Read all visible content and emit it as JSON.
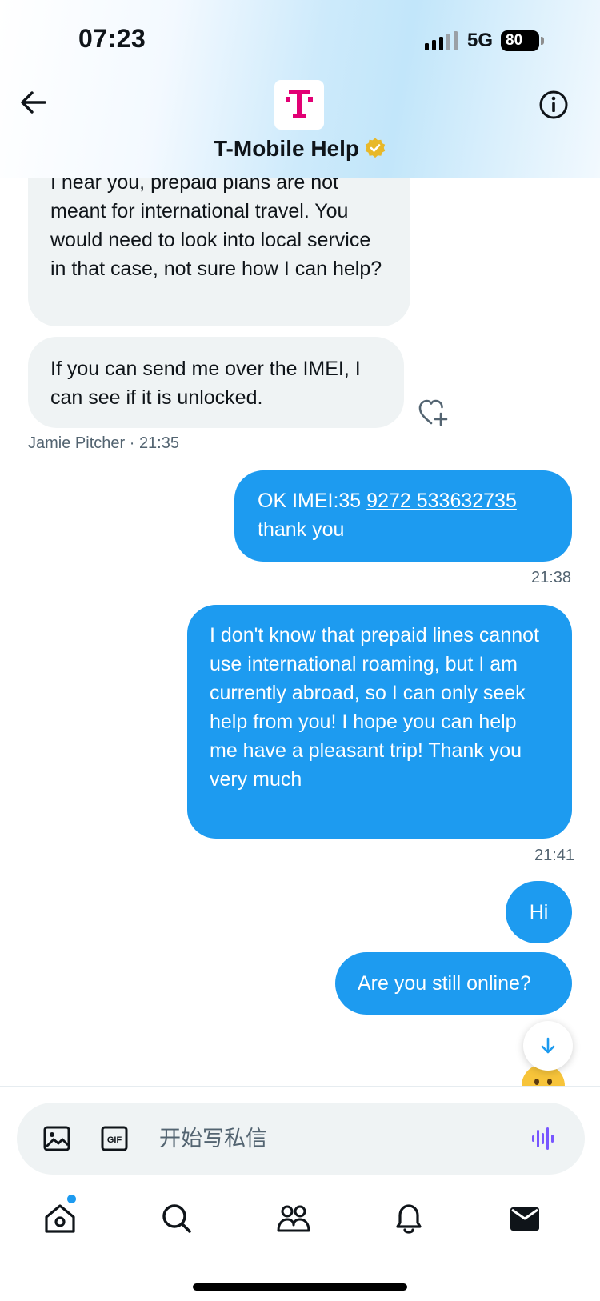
{
  "status_bar": {
    "time": "07:23",
    "network": "5G",
    "battery": "80"
  },
  "header": {
    "contact_name": "T-Mobile Help",
    "logo_letter": "T",
    "brand_color": "#e20074"
  },
  "messages": [
    {
      "direction": "incoming",
      "text": "I hear you, prepaid plans are not meant for international travel. You would need to look into local service in that case, not sure how I can help?"
    },
    {
      "direction": "incoming",
      "text": "If you can send me over the IMEI, I can see if it is unlocked."
    },
    {
      "direction": "outgoing",
      "text_prefix": "OK IMEI:35 ",
      "text_link": "9272 533632735",
      "text_suffix": " thank you"
    },
    {
      "direction": "outgoing",
      "text": "I don't know that prepaid lines cannot use international roaming, but I am currently abroad, so I can only seek help from you! I hope you can help me have a pleasant trip! Thank you very much"
    },
    {
      "direction": "outgoing",
      "text": "Hi"
    },
    {
      "direction": "outgoing",
      "text": "Are you still online?"
    }
  ],
  "meta": {
    "sender_name": "Jamie Pitcher",
    "sender_time": "21:35",
    "time_1": "21:38",
    "time_2": "21:41"
  },
  "composer": {
    "placeholder": "开始写私信",
    "media_icon": "image-icon",
    "gif_icon": "gif-icon",
    "voice_icon": "voice-wave-icon"
  },
  "tabbar": {
    "items": [
      {
        "name": "home",
        "icon": "home-icon",
        "badge": true
      },
      {
        "name": "search",
        "icon": "search-icon"
      },
      {
        "name": "communities",
        "icon": "people-icon"
      },
      {
        "name": "notifications",
        "icon": "bell-icon"
      },
      {
        "name": "messages",
        "icon": "envelope-icon",
        "active": true
      }
    ]
  },
  "colors": {
    "accent": "#1d9bf0",
    "incoming_bubble": "#eff3f4",
    "text_secondary": "#536471"
  }
}
